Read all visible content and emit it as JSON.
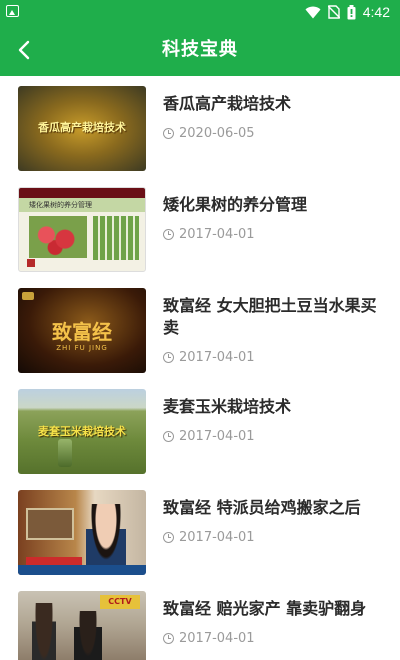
{
  "status_bar": {
    "time": "4:42",
    "icons": [
      "image-icon",
      "wifi-icon",
      "no-sim-icon",
      "battery-icon"
    ]
  },
  "app_bar": {
    "title": "科技宝典",
    "back_icon": "chevron-left-icon",
    "color": "#1fae4b"
  },
  "items": [
    {
      "title": "香瓜高产栽培技术",
      "date": "2020-06-05",
      "thumb_caption": "香瓜高产栽培技术"
    },
    {
      "title": "矮化果树的养分管理",
      "date": "2017-04-01",
      "thumb_caption": "矮化果树的养分管理"
    },
    {
      "title": "致富经 女大胆把土豆当水果买卖",
      "date": "2017-04-01",
      "thumb_caption": "致富经",
      "thumb_subcaption": "ZHI FU JING"
    },
    {
      "title": "麦套玉米栽培技术",
      "date": "2017-04-01",
      "thumb_caption": "麦套玉米栽培技术"
    },
    {
      "title": "致富经 特派员给鸡搬家之后",
      "date": "2017-04-01"
    },
    {
      "title": "致富经 赔光家产 靠卖驴翻身",
      "date": "2017-04-01",
      "thumb_caption": "CCTV"
    }
  ]
}
